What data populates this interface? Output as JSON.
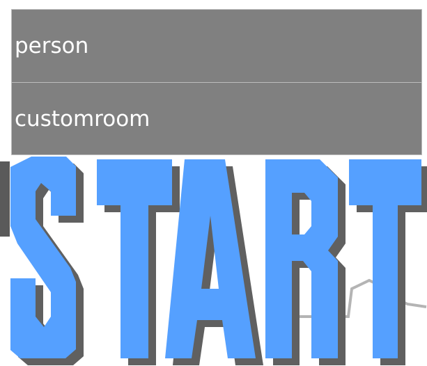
{
  "menu": {
    "items": [
      {
        "label": "person"
      },
      {
        "label": "customroom"
      }
    ]
  },
  "start_button": {
    "label": "START",
    "color": "#55a0ff",
    "shadow_color": "#606060"
  }
}
